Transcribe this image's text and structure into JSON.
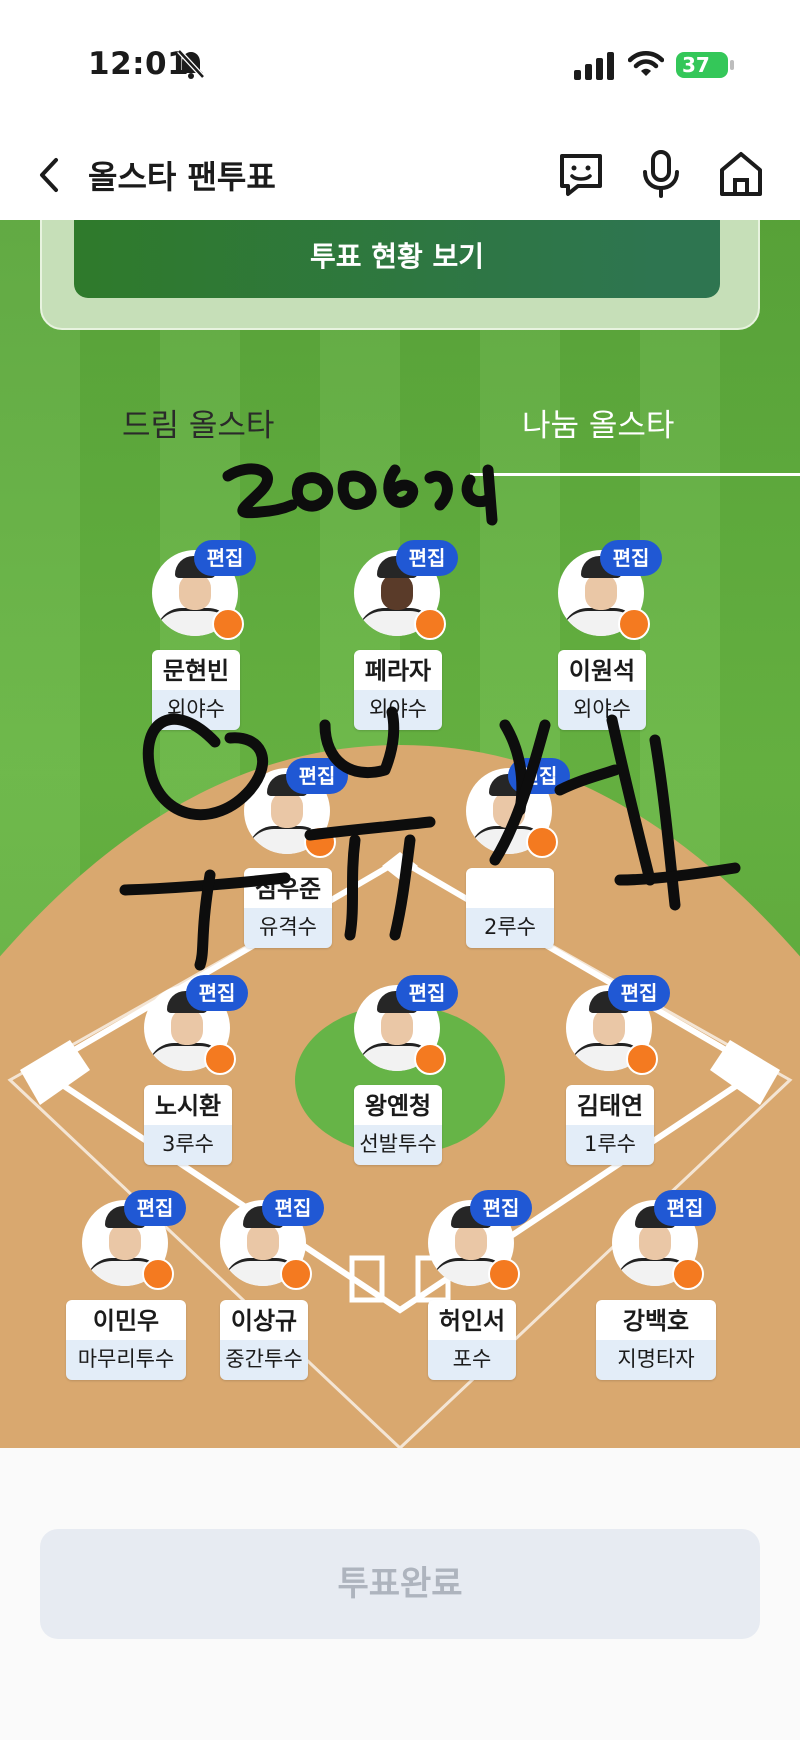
{
  "status_bar": {
    "time": "12:01",
    "battery": "37",
    "icons": [
      "bell-slash-icon",
      "cellular-signal-icon",
      "wifi-icon",
      "battery-icon"
    ]
  },
  "nav": {
    "title": "올스타 팬투표",
    "icons": [
      "back-chevron-icon",
      "chat-bot-icon",
      "microphone-icon",
      "home-icon"
    ]
  },
  "vote_status_button": "투표 현황 보기",
  "teams": {
    "dream": "드림 올스타",
    "nanum": "나눔 올스타"
  },
  "edit_label": "편집",
  "players": {
    "lf": {
      "name": "문현빈",
      "position": "외야수"
    },
    "cf": {
      "name": "페라자",
      "position": "외야수"
    },
    "rf": {
      "name": "이원석",
      "position": "외야수"
    },
    "ss": {
      "name": "심우준",
      "position": "유격수"
    },
    "b2": {
      "name": "",
      "position": "2루수"
    },
    "b3": {
      "name": "노시환",
      "position": "3루수"
    },
    "sp": {
      "name": "왕옌청",
      "position": "선발투수"
    },
    "b1": {
      "name": "김태연",
      "position": "1루수"
    },
    "cl": {
      "name": "이민우",
      "position": "마무리투수"
    },
    "rp": {
      "name": "이상규",
      "position": "중간투수"
    },
    "c": {
      "name": "허인서",
      "position": "포수"
    },
    "dh": {
      "name": "강백호",
      "position": "지명타자"
    }
  },
  "complete_button": "투표완료",
  "colors": {
    "field": "#67b542",
    "edit_badge": "#2058d4",
    "vote_status": "#2f7a2b",
    "logo": "#f47a20"
  }
}
